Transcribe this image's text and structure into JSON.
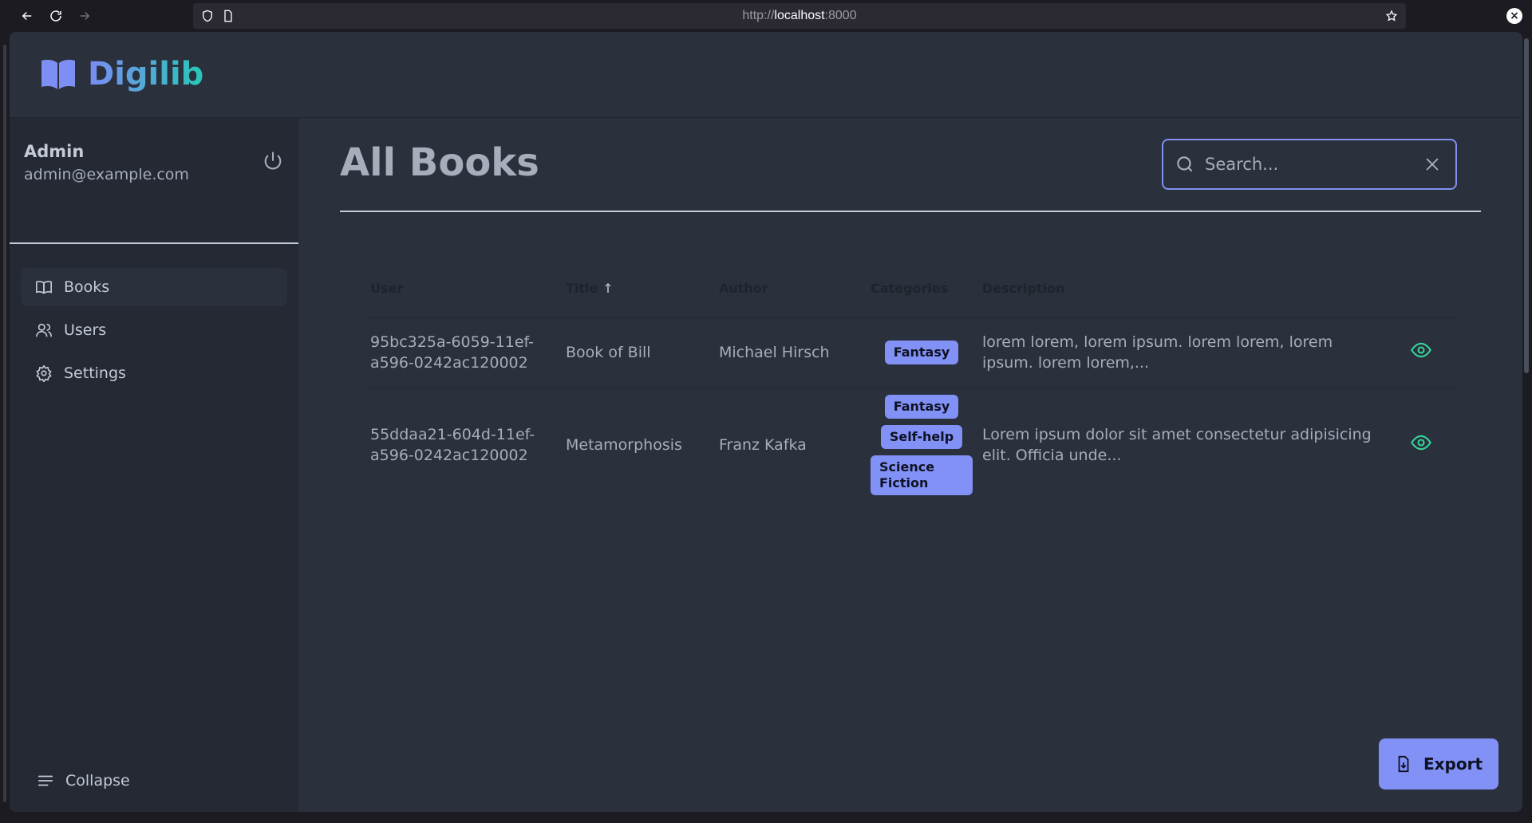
{
  "browser": {
    "url_scheme": "http://",
    "url_host": "localhost",
    "url_port": ":8000"
  },
  "app": {
    "brand": "Digilib"
  },
  "user": {
    "name": "Admin",
    "email": "admin@example.com"
  },
  "sidebar": {
    "items": [
      {
        "label": "Books",
        "icon": "book-open-icon",
        "active": true
      },
      {
        "label": "Users",
        "icon": "users-icon",
        "active": false
      },
      {
        "label": "Settings",
        "icon": "gear-icon",
        "active": false
      }
    ],
    "collapse_label": "Collapse"
  },
  "page": {
    "title": "All Books"
  },
  "search": {
    "placeholder": "Search..."
  },
  "table": {
    "headers": [
      "User",
      "Title",
      "Author",
      "Categories",
      "Description"
    ],
    "sort_indicator": "↑",
    "rows": [
      {
        "user": "95bc325a-6059-11ef-a596-0242ac120002",
        "user_line1": "95bc325a-6059-11ef-",
        "user_line2": "a596-0242ac120002",
        "title": "Book of Bill",
        "author": "Michael Hirsch",
        "categories": [
          "Fantasy"
        ],
        "description": "lorem lorem, lorem ipsum. lorem lorem, lorem ipsum. lorem lorem,..."
      },
      {
        "user": "55ddaa21-604d-11ef-a596-0242ac120002",
        "user_line1": "55ddaa21-604d-11ef-",
        "user_line2": "a596-0242ac120002",
        "title": "Metamorphosis",
        "author": "Franz Kafka",
        "categories": [
          "Fantasy",
          "Self-help",
          "Science Fiction"
        ],
        "description": "Lorem ipsum dolor sit amet consectetur adipisicing elit. Officia unde..."
      }
    ]
  },
  "actions": {
    "export_label": "Export"
  },
  "colors": {
    "primary": "#8191f6",
    "success": "#36d399",
    "background": "#2a303c",
    "sidebar": "#242933"
  }
}
